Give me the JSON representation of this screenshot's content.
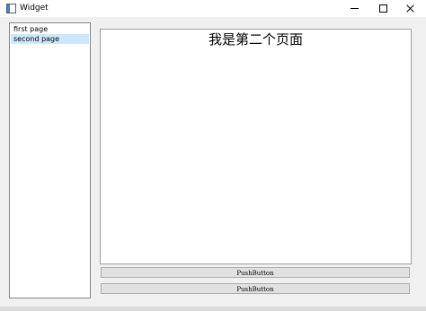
{
  "window": {
    "title": "Widget",
    "icon": "app-window-icon",
    "controls": {
      "minimize_icon": "minimize-icon",
      "maximize_icon": "maximize-icon",
      "close_icon": "close-icon"
    }
  },
  "list": {
    "items": [
      {
        "label": "first page",
        "selected": false
      },
      {
        "label": "second page",
        "selected": true
      }
    ]
  },
  "page": {
    "title": "我是第二个页面"
  },
  "buttons": {
    "push_1": "PushButton",
    "push_2": "PushButton"
  },
  "colors": {
    "selection": "#cce8ff",
    "button_face": "#e1e1e1",
    "window_bg": "#f0f0f0"
  }
}
